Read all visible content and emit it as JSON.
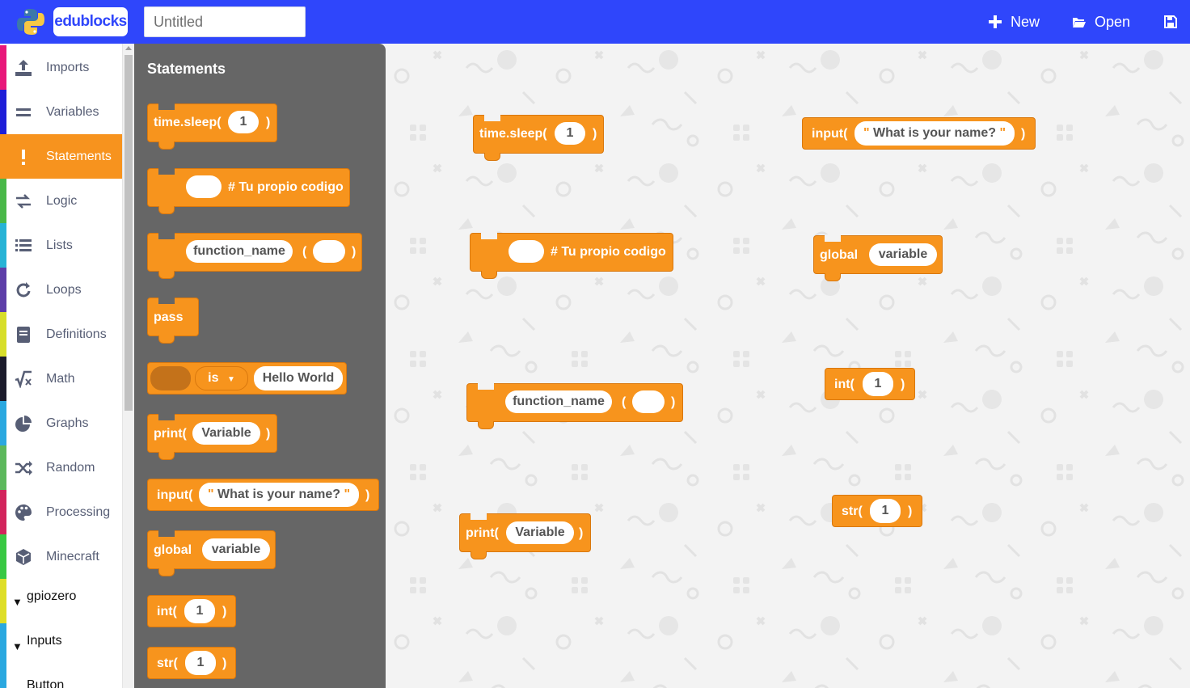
{
  "header": {
    "logo_text": "edublocks",
    "title_placeholder": "Untitled",
    "buttons": {
      "new": "New",
      "open": "Open"
    }
  },
  "sidebar": {
    "categories": [
      {
        "label": "Imports",
        "icon": "upload-icon",
        "color": "#e8177a"
      },
      {
        "label": "Variables",
        "icon": "equals-icon",
        "color": "#1e1ed8"
      },
      {
        "label": "Statements",
        "icon": "exclamation-icon",
        "color": "#f7931e"
      },
      {
        "label": "Logic",
        "icon": "swap-icon",
        "color": "#49b848"
      },
      {
        "label": "Lists",
        "icon": "list-icon",
        "color": "#27b3d6"
      },
      {
        "label": "Loops",
        "icon": "redo-icon",
        "color": "#5d3ea8"
      },
      {
        "label": "Definitions",
        "icon": "book-icon",
        "color": "#d7de2a"
      },
      {
        "label": "Math",
        "icon": "square-root-icon",
        "color": "#1b1b2b"
      },
      {
        "label": "Graphs",
        "icon": "pie-chart-icon",
        "color": "#2aa8e0"
      },
      {
        "label": "Random",
        "icon": "shuffle-icon",
        "color": "#5cb85c"
      },
      {
        "label": "Processing",
        "icon": "palette-icon",
        "color": "#d2245c"
      },
      {
        "label": "Minecraft",
        "icon": "cube-icon",
        "color": "#38c843"
      }
    ],
    "groups": [
      {
        "label": "gpiozero",
        "color": "#dede27"
      },
      {
        "label": "Inputs",
        "color": "#2aa8e0"
      }
    ],
    "sub_items": [
      {
        "label": "Button",
        "color": "#2aa8e0"
      }
    ]
  },
  "flyout": {
    "title": "Statements",
    "blocks": {
      "sleep": {
        "fn": "time.sleep(",
        "arg": "1",
        "close": ")"
      },
      "code": {
        "comment": "# Tu propio codigo"
      },
      "func": {
        "name": "function_name",
        "open": "(",
        "close": ")"
      },
      "pass": {
        "label": "pass"
      },
      "is": {
        "op": "is",
        "value": "Hello World"
      },
      "print": {
        "fn": "print(",
        "arg": "Variable",
        "close": ")"
      },
      "input": {
        "fn": "input(",
        "open_quote": "\"",
        "arg": "What is your name?",
        "close_quote": "\"",
        "close": ")"
      },
      "global": {
        "kw": "global",
        "arg": "variable"
      },
      "int": {
        "fn": "int(",
        "arg": "1",
        "close": ")"
      },
      "str": {
        "fn": "str(",
        "arg": "1",
        "close": ")"
      }
    }
  },
  "workspace": {
    "sleep": {
      "fn": "time.sleep(",
      "arg": "1",
      "close": ")"
    },
    "code": {
      "comment": "# Tu propio codigo"
    },
    "func": {
      "name": "function_name",
      "open": "(",
      "close": ")"
    },
    "print": {
      "fn": "print(",
      "arg": "Variable",
      "close": ")"
    },
    "input": {
      "fn": "input(",
      "open_quote": "\"",
      "arg": "What is your name?",
      "close_quote": "\"",
      "close": ")"
    },
    "global": {
      "kw": "global",
      "arg": "variable"
    },
    "int": {
      "fn": "int(",
      "arg": "1",
      "close": ")"
    },
    "str": {
      "fn": "str(",
      "arg": "1",
      "close": ")"
    }
  },
  "colors": {
    "header": "#2f46fb",
    "block": "#f7941d",
    "flyout": "#666666",
    "active_category": "#f7931e"
  }
}
